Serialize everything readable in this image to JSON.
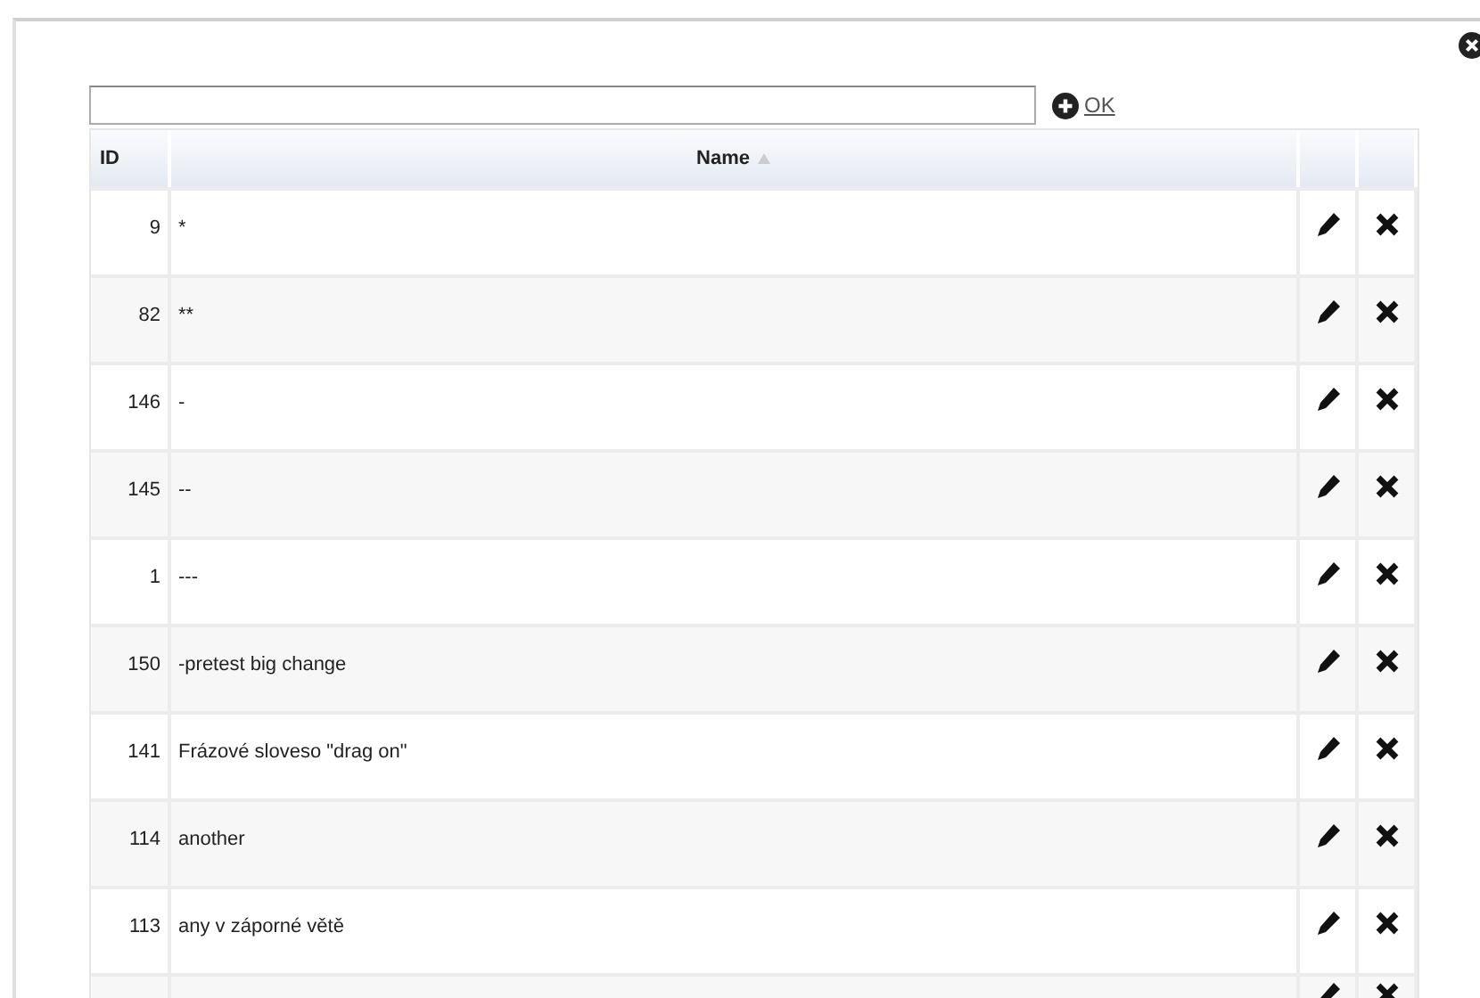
{
  "add_link": {
    "label": "OK"
  },
  "table": {
    "columns": [
      {
        "label": "ID",
        "sorted": false
      },
      {
        "label": "Name",
        "sorted": true
      }
    ],
    "rows": [
      {
        "kind": "row",
        "id": "9",
        "name": "*"
      },
      {
        "kind": "row",
        "id": "82",
        "name": "**"
      },
      {
        "kind": "row",
        "id": "146",
        "name": "-"
      },
      {
        "kind": "row",
        "id": "145",
        "name": "--"
      },
      {
        "kind": "row",
        "id": "1",
        "name": "---"
      },
      {
        "kind": "row",
        "id": "150",
        "name": "-pretest big change"
      },
      {
        "kind": "row",
        "id": "141",
        "name": "Frázové sloveso \"drag on\""
      },
      {
        "kind": "row",
        "id": "114",
        "name": "another"
      },
      {
        "kind": "row",
        "id": "113",
        "name": "any v záporné větě"
      },
      {
        "kind": "cut"
      }
    ]
  }
}
